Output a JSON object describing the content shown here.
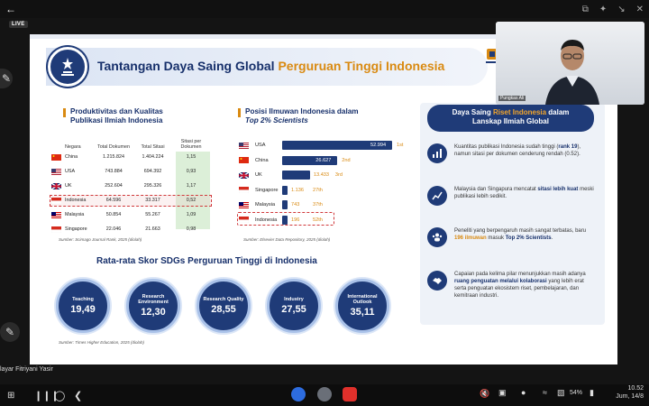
{
  "live_label": "LIVE",
  "slide": {
    "title_main": "Tantangan Daya Saing Global",
    "title_highlight": "Perguruan Tinggi Indonesia",
    "table_section": {
      "heading_line1": "Produktivitas dan Kualitas",
      "heading_line2": "Publikasi Ilmiah Indonesia",
      "headers": [
        "Negara",
        "Total Dokumen",
        "Total Sitasi",
        "Sitasi per Dokumen"
      ],
      "rows": [
        {
          "country": "China",
          "flag": "china",
          "docs": "1.215.824",
          "cites": "1.404.224",
          "ratio": "1,15"
        },
        {
          "country": "USA",
          "flag": "usa",
          "docs": "743.884",
          "cites": "694.392",
          "ratio": "0,93"
        },
        {
          "country": "UK",
          "flag": "uk",
          "docs": "252.604",
          "cites": "295.326",
          "ratio": "1,17"
        },
        {
          "country": "Indonesia",
          "flag": "indonesia",
          "docs": "64.596",
          "cites": "33.317",
          "ratio": "0,52"
        },
        {
          "country": "Malaysia",
          "flag": "malaysia",
          "docs": "50.854",
          "cites": "55.267",
          "ratio": "1,09"
        },
        {
          "country": "Singapore",
          "flag": "singapore",
          "docs": "22.046",
          "cites": "21.663",
          "ratio": "0,98"
        }
      ],
      "source": "Sumber: Scimago Journal Rank, 2025 (diolah)"
    },
    "bar_section": {
      "heading_line1": "Posisi Ilmuwan Indonesia dalam",
      "heading_line2": "Top 2% Scientists",
      "source": "Sumber: Elsevier Data Repository, 2025 (diolah)"
    },
    "chart_data": {
      "type": "bar",
      "orientation": "horizontal",
      "categories": [
        "USA",
        "China",
        "UK",
        "Singapore",
        "Malaysia",
        "Indonesia"
      ],
      "values": [
        52994,
        26627,
        13433,
        1136,
        743,
        196
      ],
      "value_labels": [
        "52.994",
        "26.627",
        "13.433",
        "1.136",
        "743",
        "196"
      ],
      "ranks": [
        "1st",
        "2nd",
        "3rd",
        "27th",
        "37th",
        "52th"
      ]
    },
    "right_panel": {
      "title_a": "Daya Saing ",
      "title_hl": "Riset Indonesia",
      "title_b": " dalam",
      "title_line2": "Lanskap Ilmiah Global",
      "items": [
        {
          "icon": "bar-chart-icon",
          "t1": "Kuantitas publikasi Indonesia sudah tinggi (",
          "b1": "rank 19",
          "t2": "), namun sitasi per dokumen cenderung rendah (0.52)."
        },
        {
          "icon": "trend-icon",
          "t1": "Malaysia dan Singapura mencatat ",
          "b1": "sitasi lebih kuat",
          "t2": " meski publikasi lebih sedikit."
        },
        {
          "icon": "people-icon",
          "t1": "Peneliti yang berpengaruh masih sangat terbatas, baru ",
          "hl": "196 ilmuwan",
          "t2": " masuk ",
          "b1": "Top 2% Scientists",
          "t3": "."
        },
        {
          "icon": "handshake-icon",
          "t1": "Capaian pada kelima pilar menunjukkan masih adanya ",
          "hl": "ruang penguatan melalui kolaborasi",
          "t2": " yang lebih erat serta penguatan ekosistem riset, pembelajaran, dan kemitraan industri."
        }
      ]
    },
    "sdg": {
      "title": "Rata-rata Skor SDGs Perguruan Tinggi di  Indonesia",
      "items": [
        {
          "label": "Teaching",
          "value": "19,49"
        },
        {
          "label": "Research Environment",
          "value": "12,30"
        },
        {
          "label": "Research Quality",
          "value": "28,55"
        },
        {
          "label": "Industry",
          "value": "27,55"
        },
        {
          "label": "International Outlook",
          "value": "35,11"
        }
      ],
      "source": "Sumber: Times Higher Education, 2025 (diolah)"
    }
  },
  "video": {
    "speaker_name": "Pungkas Ali"
  },
  "caption": "layar Fitriyani Yasir",
  "status": {
    "battery": "54%",
    "time": "10.52",
    "date": "Jum, 14/8"
  }
}
